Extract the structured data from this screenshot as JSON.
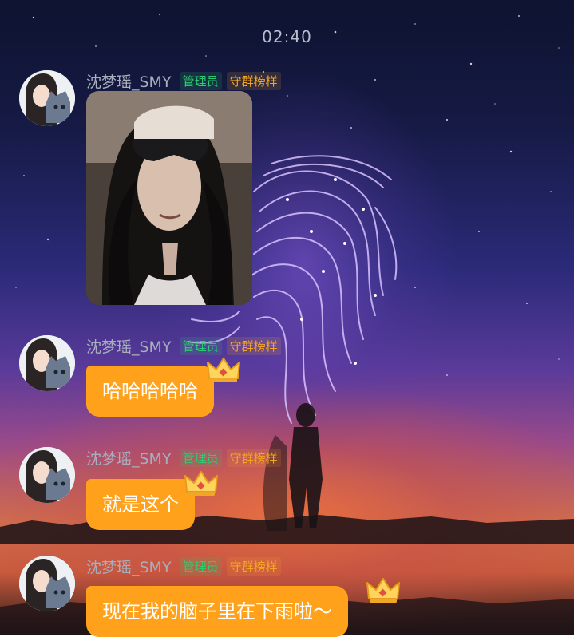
{
  "status": {
    "time": "02:40"
  },
  "sender": {
    "name": "沈梦瑶_SMY",
    "badge_admin": "管理员",
    "badge_role": "守群榜样"
  },
  "messages": [
    {
      "type": "image",
      "image_desc": "selfie-photo"
    },
    {
      "type": "text",
      "text": "哈哈哈哈哈"
    },
    {
      "type": "text",
      "text": "就是这个"
    },
    {
      "type": "text",
      "text": "现在我的脑子里在下雨啦～"
    }
  ],
  "colors": {
    "bubble": "#ffa11a",
    "admin_badge": "#2ecc71",
    "role_badge": "#f5a524",
    "username": "#a9adbd"
  },
  "icons": {
    "crown": "crown-icon",
    "avatar": "avatar-image"
  }
}
